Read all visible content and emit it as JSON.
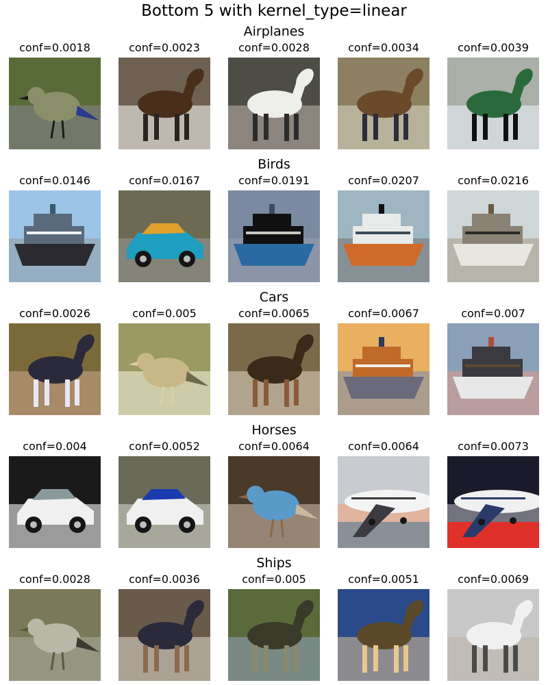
{
  "title": "Bottom 5 with kernel_type=linear",
  "rows": [
    {
      "label": "Airplanes",
      "items": [
        {
          "conf": "conf=0.0018",
          "subject": "bird"
        },
        {
          "conf": "conf=0.0023",
          "subject": "horse"
        },
        {
          "conf": "conf=0.0028",
          "subject": "horse"
        },
        {
          "conf": "conf=0.0034",
          "subject": "horse"
        },
        {
          "conf": "conf=0.0039",
          "subject": "horse"
        }
      ]
    },
    {
      "label": "Birds",
      "items": [
        {
          "conf": "conf=0.0146",
          "subject": "ship"
        },
        {
          "conf": "conf=0.0167",
          "subject": "car"
        },
        {
          "conf": "conf=0.0191",
          "subject": "ship"
        },
        {
          "conf": "conf=0.0207",
          "subject": "ship"
        },
        {
          "conf": "conf=0.0216",
          "subject": "ship"
        }
      ]
    },
    {
      "label": "Cars",
      "items": [
        {
          "conf": "conf=0.0026",
          "subject": "horse"
        },
        {
          "conf": "conf=0.005",
          "subject": "bird"
        },
        {
          "conf": "conf=0.0065",
          "subject": "horse"
        },
        {
          "conf": "conf=0.0067",
          "subject": "ship"
        },
        {
          "conf": "conf=0.007",
          "subject": "ship"
        }
      ]
    },
    {
      "label": "Horses",
      "items": [
        {
          "conf": "conf=0.004",
          "subject": "car"
        },
        {
          "conf": "conf=0.0052",
          "subject": "car"
        },
        {
          "conf": "conf=0.0064",
          "subject": "bird"
        },
        {
          "conf": "conf=0.0064",
          "subject": "airplane"
        },
        {
          "conf": "conf=0.0073",
          "subject": "airplane"
        }
      ]
    },
    {
      "label": "Ships",
      "items": [
        {
          "conf": "conf=0.0028",
          "subject": "bird"
        },
        {
          "conf": "conf=0.0036",
          "subject": "horse"
        },
        {
          "conf": "conf=0.005",
          "subject": "horse"
        },
        {
          "conf": "conf=0.0051",
          "subject": "horse"
        },
        {
          "conf": "conf=0.0069",
          "subject": "horse"
        }
      ]
    }
  ]
}
